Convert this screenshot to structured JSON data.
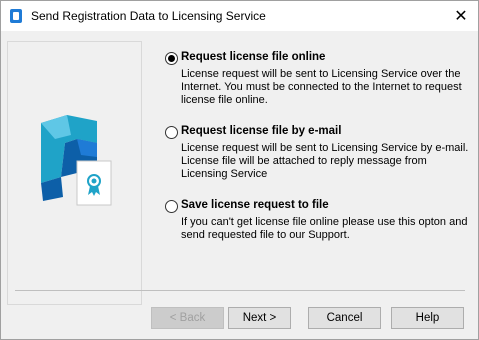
{
  "window": {
    "title": "Send Registration Data to Licensing Service",
    "close_glyph": "✕"
  },
  "options": [
    {
      "label": "Request license file online",
      "description": "License request will be sent to Licensing Service over the Internet. You must be connected to the Internet to request license file online.",
      "checked": true
    },
    {
      "label": "Request license file by e-mail",
      "description": "License request will be sent to Licensing Service by e-mail. License file will be attached to reply message from Licensing Service",
      "checked": false
    },
    {
      "label": "Save license request to file",
      "description": "If you can't get license file online please use this opton and send requested file to our Support.",
      "checked": false
    }
  ],
  "buttons": {
    "back": "< Back",
    "next": "Next >",
    "cancel": "Cancel",
    "help": "Help"
  },
  "colors": {
    "accent": "#1f7bd6",
    "logo_dark": "#0d5fa8",
    "logo_teal": "#1fa3c8",
    "logo_light": "#5fc7e6"
  },
  "icons": {
    "app": "license-app-icon",
    "logo": "license-certificate-logo"
  }
}
